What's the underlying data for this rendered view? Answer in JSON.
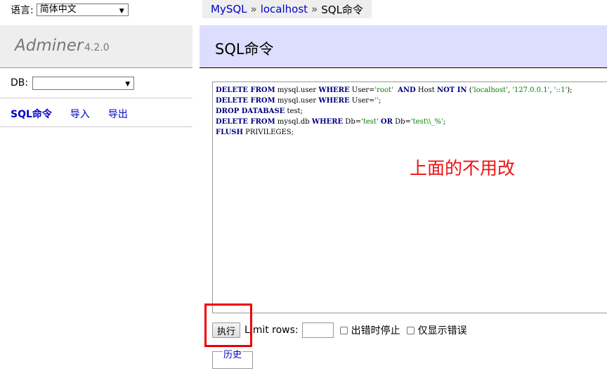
{
  "language": {
    "label": "语言:",
    "selected": "简体中文"
  },
  "brand": {
    "name": "Adminer",
    "version": "4.2.0"
  },
  "db": {
    "label": "DB:",
    "selected": ""
  },
  "nav": {
    "sql": "SQL命令",
    "import": "导入",
    "export": "导出"
  },
  "breadcrumb": {
    "server": "MySQL",
    "sep": "»",
    "host": "localhost",
    "current": "SQL命令"
  },
  "page": {
    "title": "SQL命令"
  },
  "sql": {
    "lines": [
      [
        [
          "kw",
          "DELETE FROM"
        ],
        [
          "t",
          " mysql.user "
        ],
        [
          "kw",
          "WHERE"
        ],
        [
          "t",
          " User="
        ],
        [
          "str",
          "'root'"
        ],
        [
          "t",
          "  "
        ],
        [
          "kw",
          "AND"
        ],
        [
          "t",
          " Host "
        ],
        [
          "kw",
          "NOT IN"
        ],
        [
          "t",
          " ("
        ],
        [
          "str",
          "'localhost'"
        ],
        [
          "t",
          ", "
        ],
        [
          "str",
          "'127.0.0.1'"
        ],
        [
          "t",
          ", "
        ],
        [
          "str",
          "'::1'"
        ],
        [
          "t",
          ");"
        ]
      ],
      [
        [
          "kw",
          "DELETE FROM"
        ],
        [
          "t",
          " mysql.user "
        ],
        [
          "kw",
          "WHERE"
        ],
        [
          "t",
          " User="
        ],
        [
          "str",
          "''"
        ],
        [
          "t",
          ";"
        ]
      ],
      [
        [
          "kw",
          "DROP DATABASE"
        ],
        [
          "t",
          " test;"
        ]
      ],
      [
        [
          "kw",
          "DELETE FROM"
        ],
        [
          "t",
          " mysql.db "
        ],
        [
          "kw",
          "WHERE"
        ],
        [
          "t",
          " Db="
        ],
        [
          "str",
          "'test'"
        ],
        [
          "t",
          " "
        ],
        [
          "kw",
          "OR"
        ],
        [
          "t",
          " Db="
        ],
        [
          "str",
          "'test\\\\_%'"
        ],
        [
          "t",
          ";"
        ]
      ],
      [
        [
          "kw",
          "FLUSH"
        ],
        [
          "t",
          " PRIVILEGES;"
        ]
      ]
    ]
  },
  "annotation": "上面的不用改",
  "controls": {
    "execute": "执行",
    "limit_label": "Limit rows:",
    "limit_value": "",
    "stop_on_error": "出错时停止",
    "only_errors": "仅显示错误",
    "stop_on_error_checked": false,
    "only_errors_checked": false
  },
  "history": "历史",
  "colors": {
    "highlight": "#ee0000",
    "header_bg": "#ddddff",
    "link": "#0000cc"
  }
}
